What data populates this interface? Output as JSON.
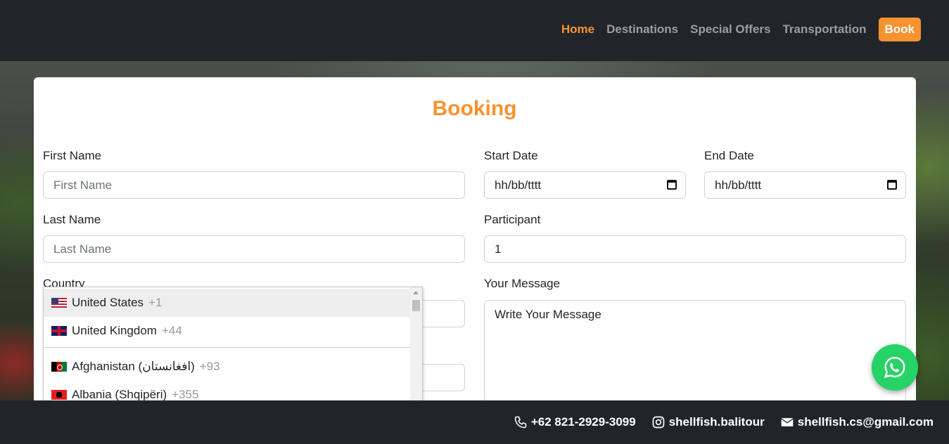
{
  "nav": {
    "home": "Home",
    "destinations": "Destinations",
    "special_offers": "Special Offers",
    "transportation": "Transportation",
    "book": "Book",
    "accent_color": "#f7922f"
  },
  "form": {
    "title": "Booking",
    "first_name_label": "First Name",
    "first_name_placeholder": "First Name",
    "last_name_label": "Last Name",
    "last_name_placeholder": "Last Name",
    "country_label": "Country",
    "start_date_label": "Start Date",
    "start_date_value": "hh/bb/tttt",
    "end_date_label": "End Date",
    "end_date_value": "hh/bb/tttt",
    "participant_label": "Participant",
    "participant_value": "1",
    "message_label": "Your Message",
    "message_placeholder": "Write Your Message"
  },
  "country_dropdown": {
    "items": [
      {
        "name": "United States",
        "dial": "+1",
        "flag": "us-flag-icon"
      },
      {
        "name": "United Kingdom",
        "dial": "+44",
        "flag": "uk-flag-icon"
      },
      {
        "name": "Afghanistan (‫افغانستان‬‎)",
        "dial": "+93",
        "flag": "af-flag-icon"
      },
      {
        "name": "Albania (Shqipëri)",
        "dial": "+355",
        "flag": "al-flag-icon"
      }
    ]
  },
  "footer": {
    "phone": "+62 821-2929-3099",
    "instagram": "shellfish.balitour",
    "email": "shellfish.cs@gmail.com"
  },
  "whatsapp": {
    "icon": "whatsapp-icon",
    "color": "#25d366"
  }
}
